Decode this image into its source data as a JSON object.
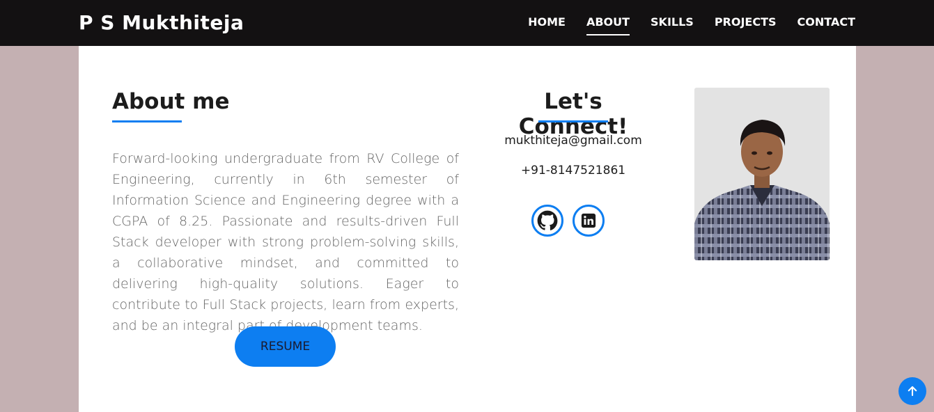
{
  "nav": {
    "brand": "P S Mukthiteja",
    "links": [
      "HOME",
      "ABOUT",
      "SKILLS",
      "PROJECTS",
      "CONTACT"
    ],
    "active": "ABOUT"
  },
  "about": {
    "title": "About me",
    "text": "Forward-looking undergraduate from RV College of Engineering, currently in 6th semester of Information Science and Engineering degree with a CGPA of 8.25. Passionate and results-driven Full Stack developer with strong problem-solving skills, a collaborative mindset, and committed to delivering high-quality solutions. Eager to contribute to Full Stack projects, learn from experts, and be an integral part of development teams.",
    "resume_label": "RESUME"
  },
  "connect": {
    "title": "Let's Connect!",
    "email": "mukthiteja@gmail.com",
    "phone": "+91-8147521861",
    "socials": [
      "github-icon",
      "linkedin-icon"
    ]
  },
  "colors": {
    "accent": "#0d7ef1",
    "navbar": "#131112",
    "page_bg": "#c4b0b2"
  }
}
